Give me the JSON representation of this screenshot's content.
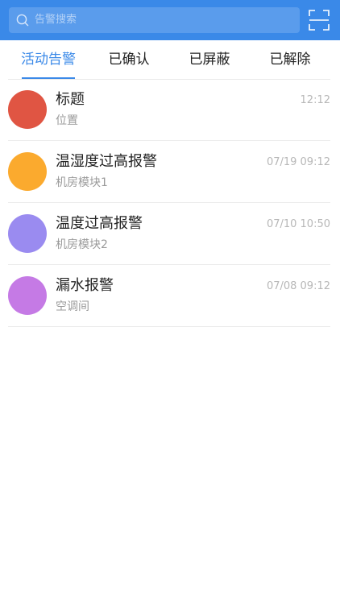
{
  "search": {
    "placeholder": "告警搜索"
  },
  "header": {
    "background": "#3a89e8",
    "scan_icon": "scan-icon",
    "search_icon": "search-icon"
  },
  "tabs": [
    {
      "label": "活动告警",
      "active": true
    },
    {
      "label": "已确认",
      "active": false
    },
    {
      "label": "已屏蔽",
      "active": false
    },
    {
      "label": "已解除",
      "active": false
    }
  ],
  "alarms": [
    {
      "title": "标题",
      "location": "位置",
      "time": "12:12",
      "color": "#e05543"
    },
    {
      "title": "温湿度过高报警",
      "location": "机房模块1",
      "time": "07/19 09:12",
      "color": "#fbaa2e"
    },
    {
      "title": "温度过高报警",
      "location": "机房模块2",
      "time": "07/10 10:50",
      "color": "#9a8bf0"
    },
    {
      "title": "漏水报警",
      "location": "空调间",
      "time": "07/08 09:12",
      "color": "#c57ae5"
    }
  ]
}
